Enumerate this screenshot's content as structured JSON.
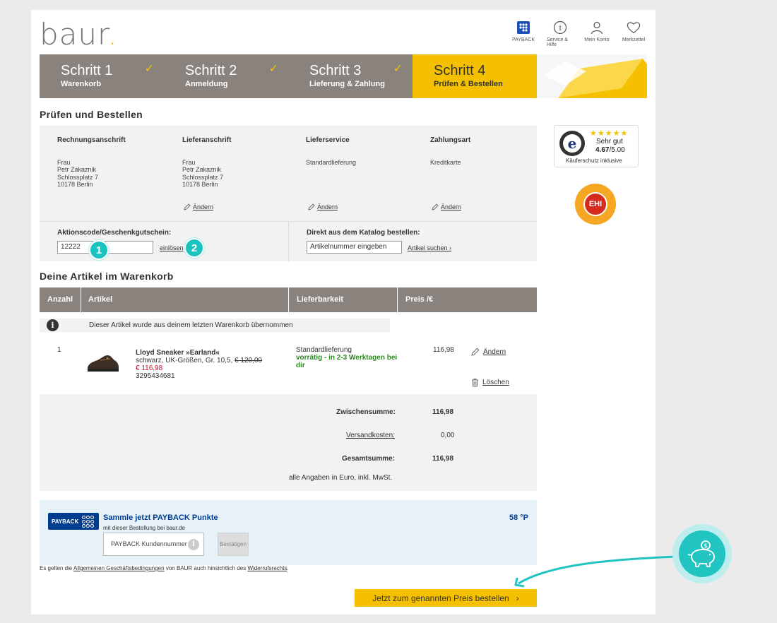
{
  "header": {
    "logo_text": "baur",
    "icons": [
      {
        "name": "payback-icon",
        "label": "PAYBACK"
      },
      {
        "name": "info-icon",
        "label": "Service & Hilfe"
      },
      {
        "name": "user-icon",
        "label": "Mein Konto"
      },
      {
        "name": "heart-icon",
        "label": "Merkzettel"
      }
    ]
  },
  "steps": [
    {
      "title": "Schritt 1",
      "sub": "Warenkorb",
      "done": true
    },
    {
      "title": "Schritt 2",
      "sub": "Anmeldung",
      "done": true
    },
    {
      "title": "Schritt 3",
      "sub": "Lieferung & Zahlung",
      "done": true
    },
    {
      "title": "Schritt 4",
      "sub": "Prüfen & Bestellen",
      "done": false
    }
  ],
  "review": {
    "heading": "Prüfen und Bestellen",
    "billing": {
      "label": "Rechnungsanschrift",
      "lines": [
        "Frau",
        "Petr Zakaznik",
        "Schlossplatz 7",
        "10178 Berlin"
      ]
    },
    "shipping": {
      "label": "Lieferanschrift",
      "lines": [
        "Frau",
        "Petr Zakaznik",
        "Schlossplatz 7",
        "10178 Berlin"
      ],
      "edit": "Ändern"
    },
    "delivery": {
      "label": "Lieferservice",
      "value": "Standardlieferung",
      "edit": "Ändern"
    },
    "payment": {
      "label": "Zahlungsart",
      "value": "Kreditkarte",
      "edit": "Ändern"
    },
    "promo": {
      "label": "Aktionscode/Geschenkgutschein:",
      "value": "12222",
      "redeem": "einlösen"
    },
    "catalog": {
      "label": "Direkt aus dem Katalog bestellen:",
      "placeholder": "Artikelnummer eingeben",
      "search": "Artikel suchen"
    },
    "step_badges": [
      "1",
      "2"
    ]
  },
  "cart": {
    "heading": "Deine Artikel im Warenkorb",
    "columns": [
      "Anzahl",
      "Artikel",
      "Lieferbarkeit",
      "Preis /€"
    ],
    "notice": "Dieser Artikel wurde aus deinem letzten Warenkorb übernommen",
    "item": {
      "qty": "1",
      "name": "Lloyd Sneaker »Earland«",
      "variant": "schwarz,  UK-Größen,  Gr. 10,5,",
      "old_price": "€ 120,00",
      "sale_price": "€ 116,98",
      "article_no": "3295434681",
      "delivery": "Standardlieferung",
      "availability": "vorrätig - in 2-3 Werktagen bei dir",
      "price": "116,98",
      "edit": "Ändern",
      "delete": "Löschen"
    }
  },
  "summary": {
    "subtotal_label": "Zwischensumme:",
    "subtotal": "116,98",
    "shipping_label": "Versandkosten:",
    "shipping": "0,00",
    "total_label": "Gesamtsumme:",
    "total": "116,98",
    "note": "alle Angaben in Euro, inkl. MwSt."
  },
  "payback": {
    "logo": "PAYBACK",
    "title": "Sammle jetzt PAYBACK Punkte",
    "sub": "mit dieser Bestellung bei baur.de",
    "points": "58 °P",
    "input_placeholder": "PAYBACK Kundennummer",
    "confirm": "Bestätigen"
  },
  "terms": {
    "pre": "Es gelten die ",
    "agb": "Allgemeinen Geschäftsbedingungen",
    "mid": " von BAUR auch hinsichtlich des ",
    "withdrawal": "Widerrufsrechts",
    "post": "."
  },
  "order_button": "Jetzt zum genannten Preis bestellen",
  "trust": {
    "rating_text": "Sehr gut",
    "score": "4.67",
    "max": "/5.00",
    "protection": "Käuferschutz inklusive"
  },
  "ehi": {
    "label": "EHI",
    "ring_text": "GEPRÜFTER ONLINE-SHOP"
  },
  "colors": {
    "accent": "#f5c000",
    "stepper": "#8a827d",
    "teal": "#1bc3c0",
    "payback_blue": "#003d8f",
    "green": "#2a8a1f",
    "red": "#c8102e"
  }
}
